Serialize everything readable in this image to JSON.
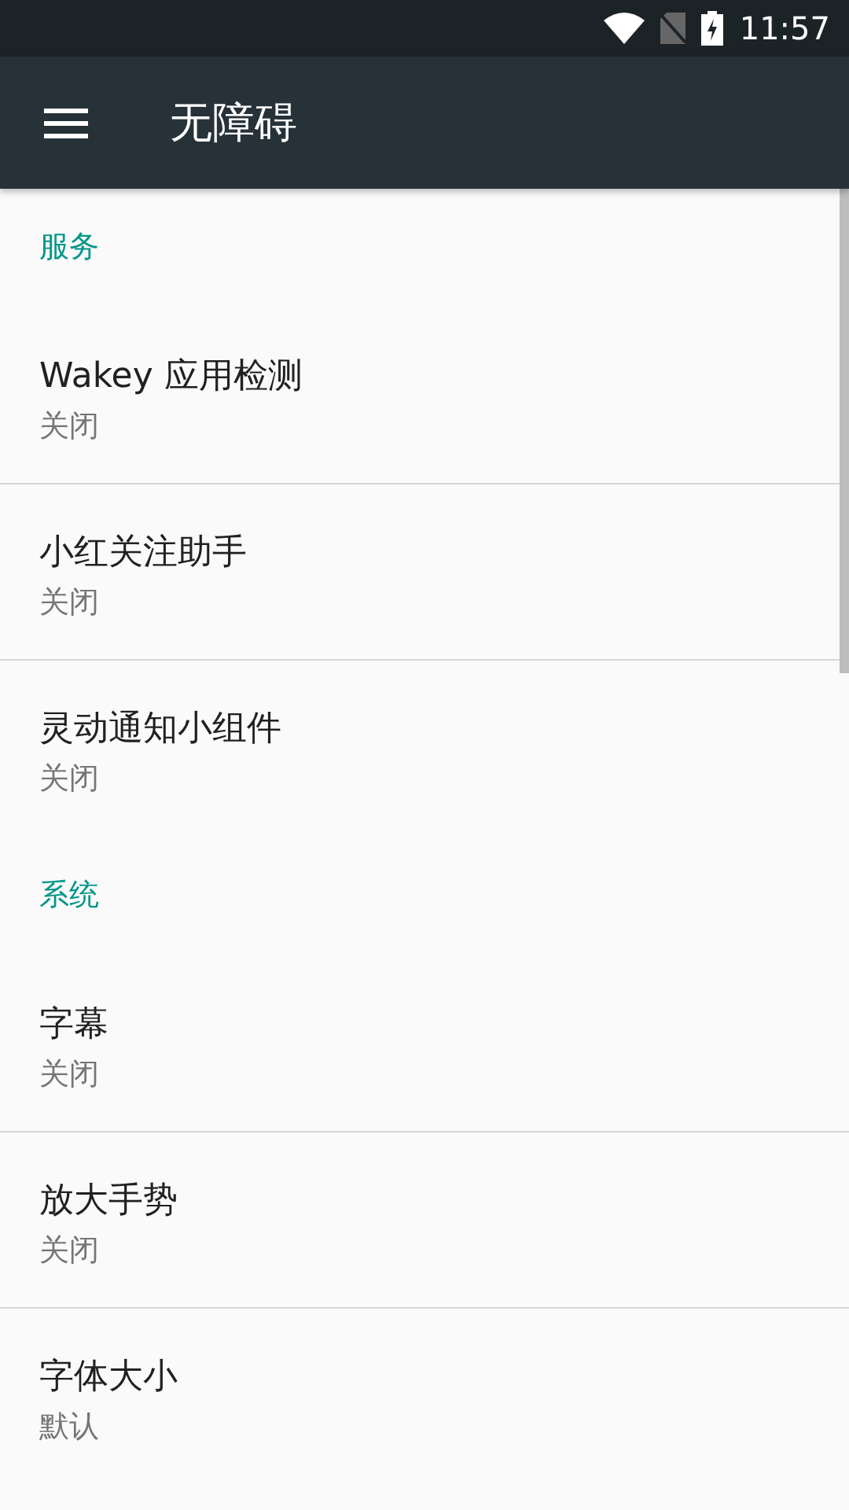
{
  "status_bar": {
    "time": "11:57"
  },
  "toolbar": {
    "title": "无障碍"
  },
  "sections": [
    {
      "header": "服务",
      "items": [
        {
          "title": "Wakey 应用检测",
          "summary": "关闭"
        },
        {
          "title": "小红关注助手",
          "summary": "关闭"
        },
        {
          "title": "灵动通知小组件",
          "summary": "关闭"
        }
      ]
    },
    {
      "header": "系统",
      "items": [
        {
          "title": "字幕",
          "summary": "关闭"
        },
        {
          "title": "放大手势",
          "summary": "关闭"
        },
        {
          "title": "字体大小",
          "summary": "默认"
        }
      ]
    }
  ]
}
